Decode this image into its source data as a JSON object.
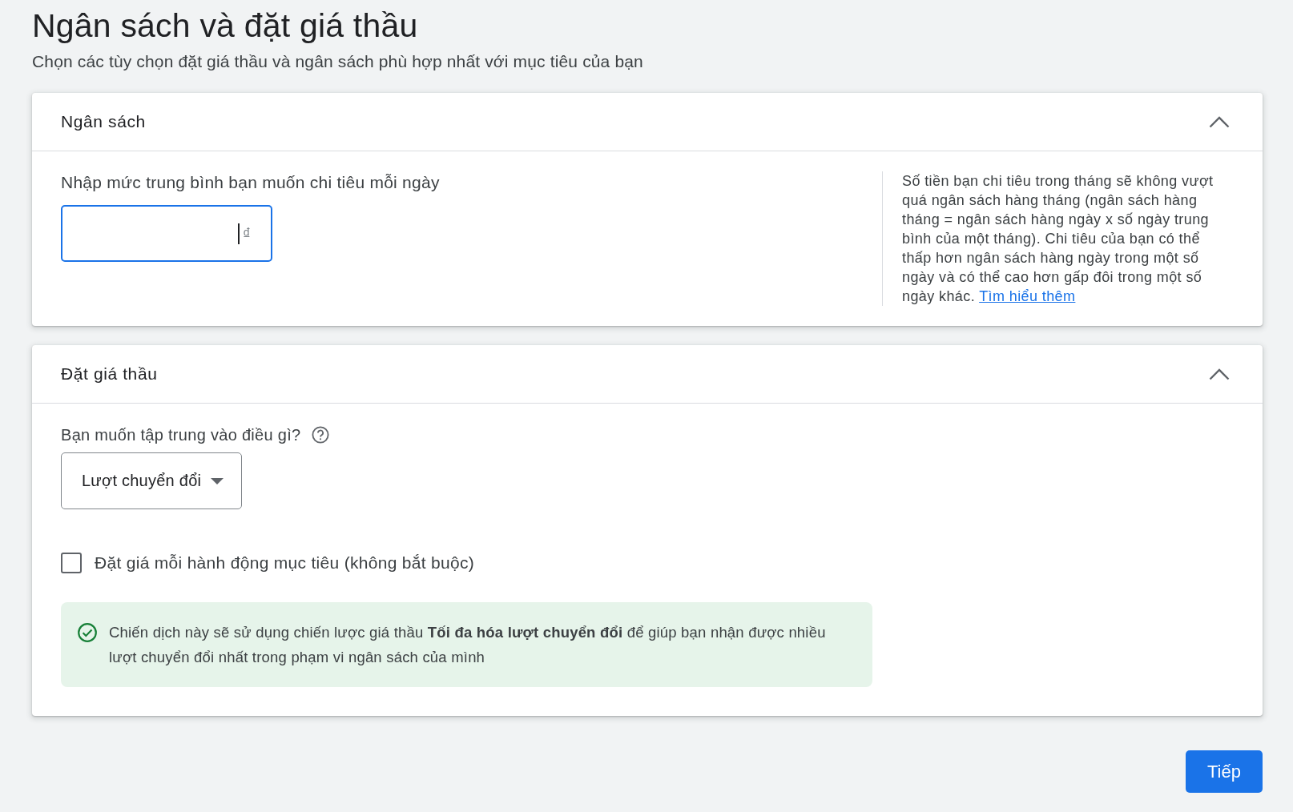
{
  "page": {
    "title": "Ngân sách và đặt giá thầu",
    "subtitle": "Chọn các tùy chọn đặt giá thầu và ngân sách phù hợp nhất với mục tiêu của bạn"
  },
  "sections": [
    {
      "kind": "budget",
      "title": "Ngân sách",
      "expanded": true,
      "field_label": "Nhập mức trung bình bạn muốn chi tiêu mỗi ngày",
      "input": {
        "currency": "₫",
        "focused": true
      },
      "help": {
        "text": "Số tiền bạn chi tiêu trong tháng sẽ không vượt quá ngân sách hàng tháng (ngân sách hàng tháng = ngân sách hàng ngày x số ngày trung bình của một tháng). Chi tiêu của bạn có thể thấp hơn ngân sách hàng ngày trong một số ngày và có thể cao hơn gấp đôi trong một số ngày khác.",
        "link": "Tìm hiểu thêm"
      }
    },
    {
      "kind": "bidding",
      "title": "Đặt giá thầu",
      "expanded": true,
      "question": "Bạn muốn tập trung vào điều gì?",
      "dropdown": {
        "value": "Lượt chuyển đổi"
      },
      "checkbox": {
        "label": "Đặt giá mỗi hành động mục tiêu (không bắt buộc)",
        "checked": false
      },
      "notice": {
        "text": "Chiến dịch này sẽ sử dụng chiến lược giá thầu **Tối đa hóa lượt chuyển đổi** để giúp bạn nhận được nhiều lượt chuyển đổi nhất trong phạm vi ngân sách của mình"
      }
    }
  ],
  "next_button": {
    "label": "Tiếp"
  }
}
